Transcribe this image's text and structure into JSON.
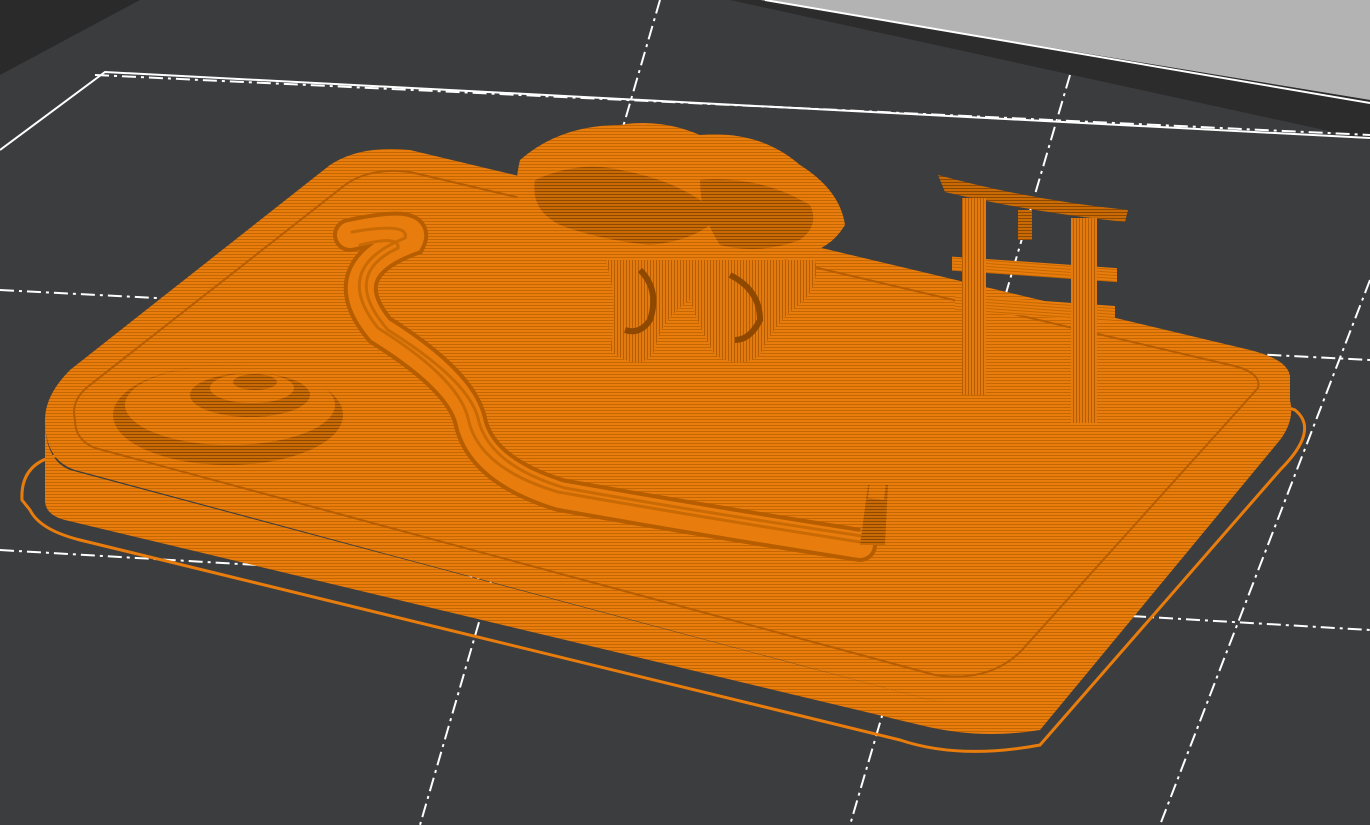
{
  "app": {
    "view": "slicer-preview-3d"
  },
  "colors": {
    "background_far": "#b3b3b3",
    "bed_edge": "#2a2a2b",
    "bed_surface": "#3c3d3f",
    "grid_line": "#ffffff",
    "filament": "#e87d0d",
    "filament_dark": "#b65d00",
    "filament_shadow": "#8f4800",
    "filament_light": "#f5922a"
  },
  "scene": {
    "objects": [
      {
        "kind": "skirt-outline",
        "icon": "skirt-icon"
      },
      {
        "kind": "tray-base",
        "icon": "tray-icon"
      },
      {
        "kind": "rock-mound",
        "icon": "rock-icon"
      },
      {
        "kind": "raked-sand-wave",
        "icon": "wave-icon"
      },
      {
        "kind": "bonsai-tree",
        "icon": "tree-icon"
      },
      {
        "kind": "torii-gate",
        "icon": "torii-icon"
      },
      {
        "kind": "rake",
        "icon": "rake-icon"
      }
    ]
  }
}
